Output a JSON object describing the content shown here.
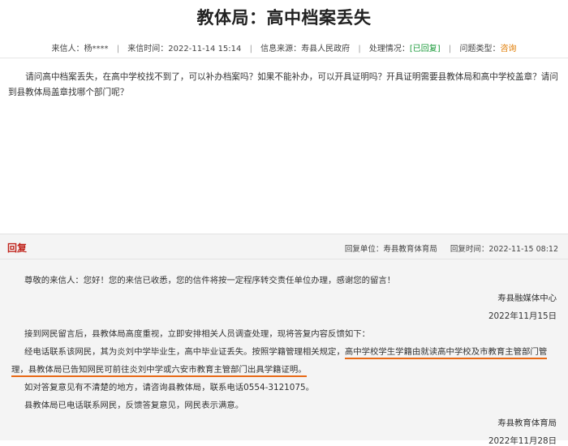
{
  "page": {
    "title": "教体局：高中档案丢失"
  },
  "meta": {
    "sender": "来信人：杨****",
    "time": "来信时间：2022-11-14 15:14",
    "source": "信息来源：寿县人民政府",
    "status_label": "处理情况：",
    "status_value": "[已回复]",
    "type_label": "问题类型：",
    "type_value": "咨询"
  },
  "question": {
    "text": "请问高中档案丢失，在高中学校找不到了，可以补办档案吗？如果不能补办，可以开具证明吗？开具证明需要县教体局和高中学校盖章？请问到县教体局盖章找哪个部门呢？"
  },
  "reply": {
    "heading": "回复",
    "unit": "回复单位：寿县教育体育局",
    "time": "回复时间：2022-11-15 08:12",
    "p1": "尊敬的来信人：您好！您的来信已收悉，您的信件将按一定程序转交责任单位办理，感谢您的留言！",
    "sign1": "寿县融媒体中心",
    "date1": "2022年11月15日",
    "p2": "接到网民留言后，县教体局高度重视，立即安排相关人员调查处理，现将答复内容反馈如下：",
    "p3a": "经电话联系该网民，其为炎刘中学毕业生，高中毕业证丢失。按照学籍管理相关规定，",
    "p3b": "高中学校学生学籍由就读高中学校及市教育主管部门管",
    "p4a": "理，",
    "p4b": "县教体局已告知网民可前往炎刘中学或六安市教育主管部门出具学籍证明。",
    "p5": "如对答复意见有不清楚的地方，请咨询县教体局，联系电话0554-3121075。",
    "p6": "县教体局已电话联系网民，反馈答复意见，网民表示满意。",
    "sign2": "寿县教育体育局",
    "date2": "2022年11月28日"
  },
  "colors": {
    "reply_heading": "#c0241c",
    "status": "#1a9a3a",
    "question_type": "#e07b00",
    "underline": "#e86a16"
  }
}
